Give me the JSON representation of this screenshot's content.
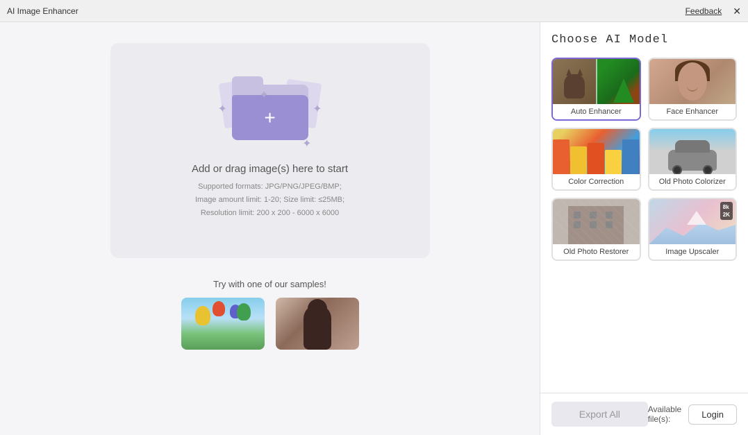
{
  "titlebar": {
    "title": "AI Image Enhancer",
    "feedback_label": "Feedback",
    "close_label": "✕"
  },
  "left_panel": {
    "drop_zone": {
      "main_text": "Add or drag image(s) here to start",
      "subtext_line1": "Supported formats: JPG/PNG/JPEG/BMP;",
      "subtext_line2": "Image amount limit: 1-20; Size limit: ≤25MB;",
      "subtext_line3": "Resolution limit: 200 x 200 - 6000 x 6000"
    },
    "samples": {
      "label": "Try with one of our samples!",
      "items": [
        {
          "name": "balloons-sample",
          "alt": "Hot air balloons"
        },
        {
          "name": "girl-sample",
          "alt": "Girl from behind"
        }
      ]
    }
  },
  "right_panel": {
    "title": "Choose AI Model",
    "models": [
      {
        "id": "auto-enhancer",
        "label": "Auto Enhancer",
        "selected": true
      },
      {
        "id": "face-enhancer",
        "label": "Face Enhancer",
        "selected": false
      },
      {
        "id": "color-correction",
        "label": "Color Correction",
        "selected": false
      },
      {
        "id": "old-photo-colorizer",
        "label": "Old Photo Colorizer",
        "selected": false
      },
      {
        "id": "old-photo-restorer",
        "label": "Old Photo Restorer",
        "selected": false
      },
      {
        "id": "image-upscaler",
        "label": "Image Upscaler",
        "selected": false
      }
    ]
  },
  "bottom_bar": {
    "export_all_label": "Export All",
    "available_files_label": "Available file(s):",
    "login_label": "Login"
  },
  "colors": {
    "accent": "#7b68d4",
    "disabled": "#e8e8ee"
  }
}
